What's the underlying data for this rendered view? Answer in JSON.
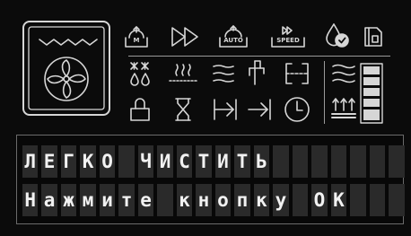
{
  "display": {
    "line1": "ЛЕГКО ЧИСТИТЬ",
    "line2": "Нажмите кнопку ОК",
    "cells_per_line": 20
  },
  "icons": {
    "manual_label": "M",
    "auto_label": "AUTO",
    "speed_label": "SPEED"
  },
  "colors": {
    "icon": "#d6d6d6",
    "segment_off": "#2a2a2a",
    "text": "#f2f2f2",
    "background": "#0b0b0b"
  }
}
